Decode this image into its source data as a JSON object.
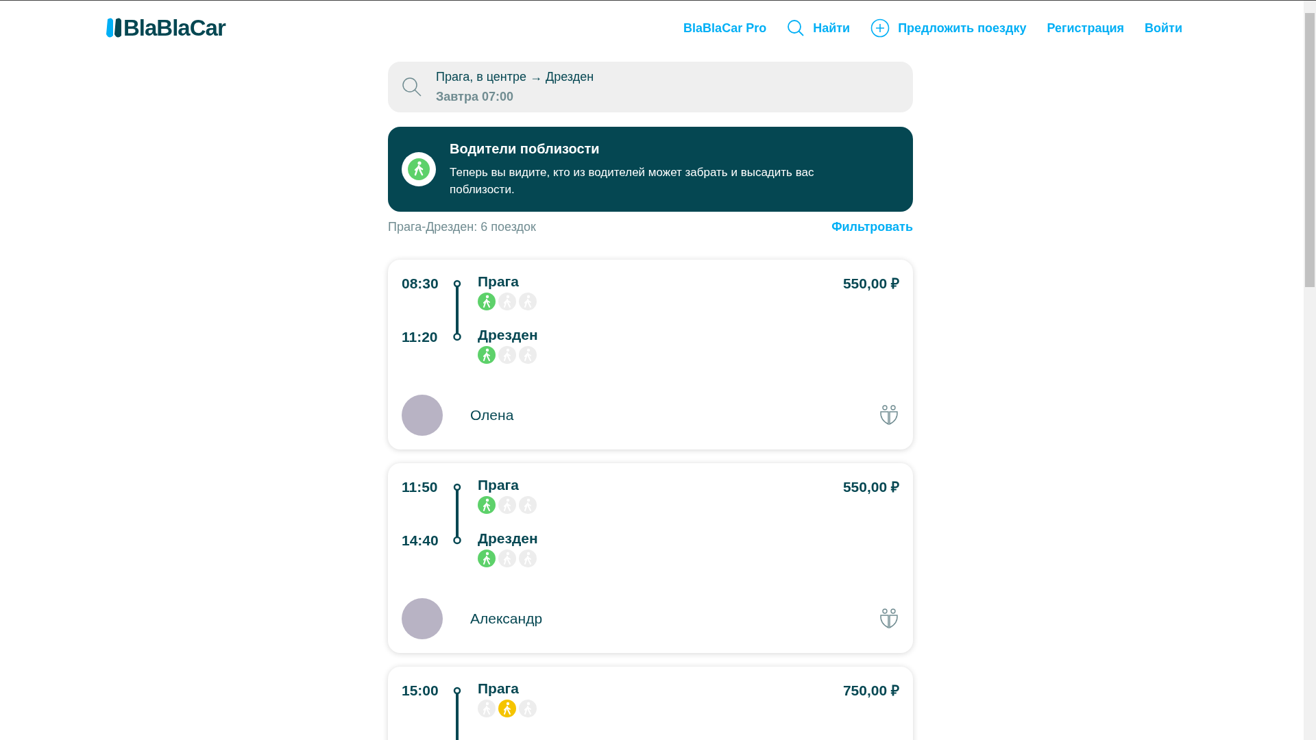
{
  "header": {
    "logo": "BlaBlaCar",
    "nav": [
      {
        "kind": "link",
        "label": "BlaBlaCar Pro"
      },
      {
        "kind": "search",
        "label": "Найти"
      },
      {
        "kind": "offer",
        "label": "Предложить поездку"
      },
      {
        "kind": "link",
        "label": "Регистрация"
      },
      {
        "kind": "link",
        "label": "Войти"
      }
    ]
  },
  "search": {
    "route": "Прага, в центре → Дрезден",
    "when": "Завтра 07:00"
  },
  "banner": {
    "title": "Водители поблизости",
    "text": "Теперь вы видите, кто из водителей может забрать и высадить вас поблизости."
  },
  "summary": {
    "count": "Прага-Дрезден: 6 поездок",
    "filter": "Фильтровать"
  },
  "trips": [
    {
      "price": "550,00 ₽",
      "stops": [
        {
          "time": "08:30",
          "city": "Прага",
          "walk": [
            {
              "color": "#5dd16a"
            },
            {
              "color": "#ededed"
            },
            {
              "color": "#ededed"
            }
          ]
        },
        {
          "time": "11:20",
          "city": "Дрезден",
          "walk": [
            {
              "color": "#5dd16a"
            },
            {
              "color": "#ededed"
            },
            {
              "color": "#ededed"
            }
          ]
        }
      ],
      "driver": {
        "name": "Олена"
      }
    },
    {
      "price": "550,00 ₽",
      "stops": [
        {
          "time": "11:50",
          "city": "Прага",
          "walk": [
            {
              "color": "#5dd16a"
            },
            {
              "color": "#ededed"
            },
            {
              "color": "#ededed"
            }
          ]
        },
        {
          "time": "14:40",
          "city": "Дрезден",
          "walk": [
            {
              "color": "#5dd16a"
            },
            {
              "color": "#ededed"
            },
            {
              "color": "#ededed"
            }
          ]
        }
      ],
      "driver": {
        "name": "Александр"
      }
    },
    {
      "price": "750,00 ₽",
      "stops": [
        {
          "time": "15:00",
          "city": "Прага",
          "walk": [
            {
              "color": "#ededed"
            },
            {
              "color": "#f5c400"
            },
            {
              "color": "#ededed"
            }
          ]
        }
      ]
    }
  ]
}
